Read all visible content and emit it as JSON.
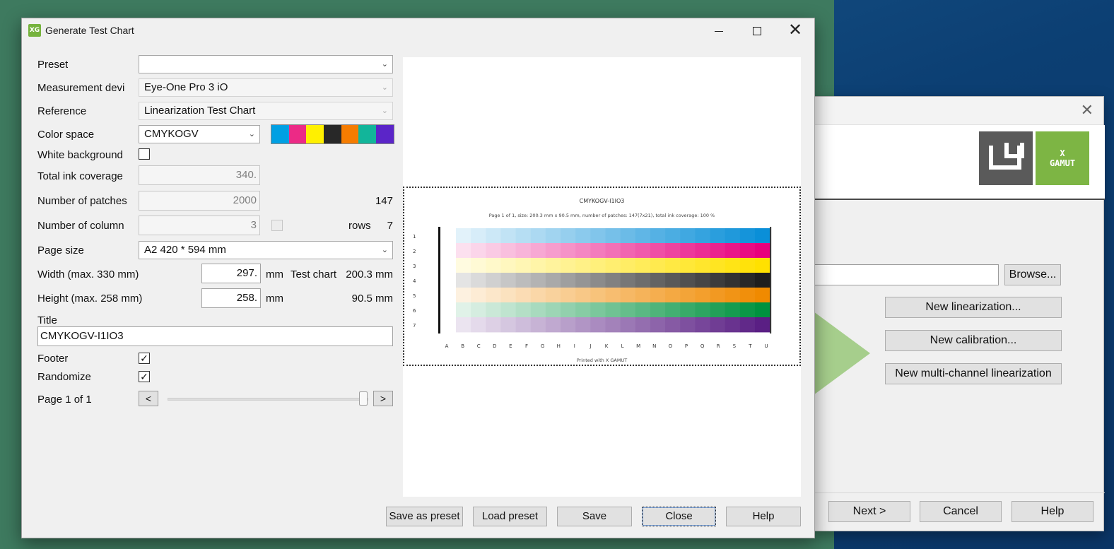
{
  "dialog": {
    "icon_text": "XG",
    "title": "Generate Test Chart",
    "labels": {
      "preset": "Preset",
      "measurement_device": "Measurement devi",
      "reference": "Reference",
      "color_space": "Color space",
      "white_background": "White background",
      "total_ink_coverage": "Total ink coverage",
      "number_of_patches": "Number of patches",
      "number_of_columns": "Number of column",
      "page_size": "Page size",
      "width": "Width (max. 330 mm)",
      "height": "Height (max. 258 mm)",
      "title": "Title",
      "footer": "Footer",
      "randomize": "Randomize",
      "page_info": "Page 1 of 1"
    },
    "values": {
      "preset": "",
      "measurement_device": "Eye-One Pro 3 iO",
      "reference": "Linearization Test Chart",
      "color_space": "CMYKOGV",
      "total_ink_coverage": "340.",
      "number_of_patches": "2000",
      "patches_count": "147",
      "number_of_columns": "3",
      "rows_label": "rows",
      "rows_value": "7",
      "page_size": "A2 420 * 594  mm",
      "width": "297.",
      "height": "258.",
      "mm_unit": "mm",
      "test_chart_label": "Test chart",
      "test_chart_width": "200.3 mm",
      "test_chart_height": "90.5 mm",
      "title_value": "CMYKOGV-I1IO3",
      "footer_check": "✓",
      "randomize_check": "✓",
      "white_bg_check": ""
    },
    "swatch_colors": [
      "#00a0e3",
      "#ec2a86",
      "#fff000",
      "#282828",
      "#f57c00",
      "#12b59a",
      "#5b25c8"
    ],
    "page_prev": "<",
    "page_next": ">",
    "buttons": {
      "save_as_preset": "Save as preset",
      "load_preset": "Load preset",
      "save": "Save",
      "close": "Close",
      "help": "Help"
    }
  },
  "preview": {
    "chart_title": "CMYKOGV-I1IO3",
    "chart_subtitle": "Page 1 of 1, size: 200.3 mm x 90.5 mm, number of patches: 147(7x21), total ink coverage: 100 %",
    "chart_footer": "Printed with X GAMUT",
    "row_labels": [
      "1",
      "2",
      "3",
      "4",
      "5",
      "6",
      "7"
    ],
    "col_labels": [
      "A",
      "B",
      "C",
      "D",
      "E",
      "F",
      "G",
      "H",
      "I",
      "J",
      "K",
      "L",
      "M",
      "N",
      "O",
      "P",
      "Q",
      "R",
      "S",
      "T",
      "U"
    ],
    "ink_colors": [
      "#0a8fd8",
      "#e8007d",
      "#ffe100",
      "#1e1e1e",
      "#f08a00",
      "#00923f",
      "#5a1f84"
    ]
  },
  "wizard": {
    "logo_text": "X\nGAMUT",
    "browse": "Browse...",
    "new_linearization": "New linearization...",
    "new_calibration": "New calibration...",
    "new_multi_channel": "New multi-channel linearization",
    "next": "Next >",
    "cancel": "Cancel",
    "help": "Help"
  }
}
